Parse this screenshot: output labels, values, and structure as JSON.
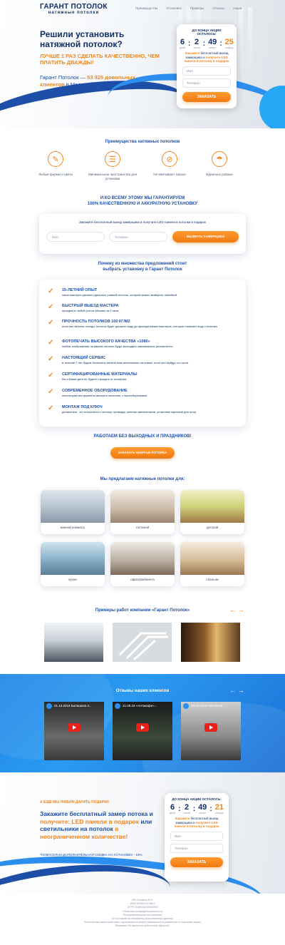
{
  "header": {
    "logo_line1": "ГАРАНТ ПОТОЛОК",
    "logo_line2": "натяжные потолки",
    "nav": [
      "Преимущества",
      "Установка",
      "Примеры",
      "Отзывы",
      "Акции"
    ]
  },
  "hero": {
    "title": "Решили установить натяжной потолок?",
    "orange": "ЛУЧШЕ 1 РАЗ СДЕЛАТЬ КАЧЕСТВЕННО, ЧЕМ ПЛАТИТЬ ДВАЖДЫ!",
    "sub_before": "Гарант Потолок — ",
    "sub_highlight": "53 325 довольных клиентов",
    "sub_after": " в Москве"
  },
  "timer_top": {
    "title": "до конца акции осталось:",
    "days": "6",
    "hours": "2",
    "minutes": "49",
    "seconds": "25",
    "u_days": "дней",
    "u_hours": "часов",
    "u_minutes": "минут",
    "u_seconds": "секунд",
    "text_a": "Закажите",
    "text_b": " бесплатный выезд замерщика и ",
    "text_c": "получите LED панели в потолку в подарок",
    "name_ph": "Имя",
    "phone_ph": "Телефон",
    "button": "ЗАКАЗАТЬ"
  },
  "advantages": {
    "title": "Преимущества натяжных потолков",
    "items": [
      {
        "icon": "palette-icon",
        "label": "Любые формы и цвета"
      },
      {
        "icon": "ladder-icon",
        "label": "Минимальное пространства для установки"
      },
      {
        "icon": "no-smell-icon",
        "label": "Не впитывают запахи"
      },
      {
        "icon": "lamp-icon",
        "label": "Идеально ровные"
      }
    ]
  },
  "guarantee": {
    "line1": "И КО ВСЕМУ ЭТОМУ МЫ ГАРАНТИРУЕМ",
    "line2": "100% КАЧЕСТВЕННУЮ И АККУРАТНУЮ УСТАНОВКУ"
  },
  "form_strip": {
    "text": "Закажите бесплатный выезд замерщика и получите LED панели в потолки в подарок",
    "name_ph": "Имя",
    "phone_ph": "Телефон",
    "button": "ВЫЗВАТЬ ЗАМЕРЩИКА"
  },
  "why": {
    "line1": "Почему из множества предложений стоит",
    "line2": "выбрать установку в Гарант Потолок",
    "items": [
      {
        "h": "15-ЛЕТНИЙ ОПЫТ",
        "p": "наши мастера сделают идеально ровный потолок, который можно выверить линейкой"
      },
      {
        "h": "БЫСТРЫЙ ВЫЕЗД МАСТЕРА",
        "p": "приедем в любой уголок Москвы за 2 часа"
      },
      {
        "h": "ПРОЧНОСТЬ ПОТОЛКОВ 100 КГ/М2",
        "p": "если вас затопят соседи, потолок будет держать воду до приезда наших мастеров, которые откачают воду с потолка"
      },
      {
        "h": "ФОТОПЕЧАТЬ ВЫСОКОГО КАЧЕСТВА «1080»",
        "p": "любые изображения на вашем потолке будут выглядеть максимально реалистично"
      },
      {
        "h": "НАСТОЯЩИЙ СЕРВИС",
        "p": "в течение 2 лет будем бесплатно менять вам светильники на новые, если они выйдут из строя"
      },
      {
        "h": "СЕРТИФИЦИРОВАННЫЕ МАТЕРИАЛЫ",
        "p": "Вы и Ваши дети не будете страдать от аллергии"
      },
      {
        "h": "СОВРЕМЕННОЕ ОБОРУДОВАНИЕ",
        "p": "используем инструменты высшего качества, с пылесборниками"
      },
      {
        "h": "МОНТАЖ ПОД КЛЮЧ",
        "p": "делаем все, что относиться к потолку: проводку, монтаж светильников, установка карнизов для штор"
      }
    ]
  },
  "work_days": "РАБОТАЕМ БЕЗ ВЫХОДНЫХ И ПРАЗДНИКОВ!",
  "order_button": "ЗАКАЗАТЬ МОНТАЖ ПОТОЛКА",
  "rooms": {
    "title": "Мы предлагаем натяжные потолки для:",
    "items": [
      "ванной комнаты",
      "гостиной",
      "детской",
      "кухни",
      "офиса/кабинета",
      "спальни"
    ]
  },
  "examples_title": "Примеры работ компании «Гарант Потолок»",
  "reviews": {
    "title": "Отзывы наших клиентов",
    "videos": [
      "01.10.2018 Балашиха 4...",
      "21.09.18 «Антикафе»...",
      "15.04.2019 Натяжной ..."
    ]
  },
  "bottom": {
    "gift_line": "А ЕЩЕ МЫ ЛЮБИМ ДАРИТЬ ПОДАРКИ",
    "p1": "Закажите бесплатный замер потока и ",
    "p2": "получите: LED панели в подарок",
    "p3": " или светильники на потолок ",
    "p4": "в неограниченном количестве!",
    "note": "*НОВОСЕЛАМ ДОПОЛНИТЕЛЬНАЯ СКИДКА НА УСТАНОВКУ - 15%"
  },
  "timer_bottom": {
    "title": "до конца акции осталось:",
    "days": "6",
    "hours": "2",
    "minutes": "49",
    "seconds": "21",
    "u_days": "дней",
    "u_hours": "часов",
    "u_minutes": "минут",
    "u_seconds": "секунд",
    "text_a": "Закажите",
    "text_b": " бесплатный выезд замерщика и ",
    "text_c": "получите LED панели в потолку в подарок",
    "name_ph": "Имя",
    "phone_ph": "Телефон",
    "button": "ЗАКАЗАТЬ"
  },
  "footer": {
    "lines": [
      "ИП Осипков В.Ф.",
      "ИНН 503307474661",
      "ОГРН 318503200031090",
      "Политика конфиденциальности",
      "Пользовательское соглашение",
      "☑ Согласие на обработку персональных данных",
      "*Количество акционных мест ограничено и может измениться в указанную в описании акции.",
      "Реклама. Не является публичной офертой."
    ]
  },
  "colors": {
    "navy": "#0f2e66",
    "blue": "#1e4fa8",
    "sky": "#2c8ff0",
    "orange": "#f0861e"
  }
}
